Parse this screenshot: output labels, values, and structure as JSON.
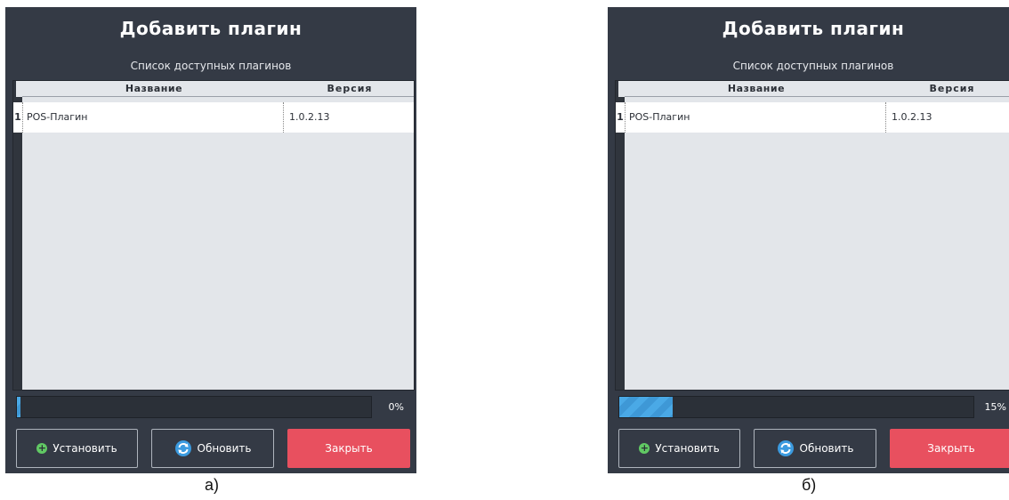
{
  "panels": [
    {
      "title": "Добавить плагин",
      "subtitle": "Список доступных плагинов",
      "table": {
        "columns": [
          "Название",
          "Версия"
        ],
        "rows": [
          {
            "num": "1",
            "name": "POS-Плагин",
            "version": "1.0.2.13"
          }
        ]
      },
      "progress": {
        "value": 0.0,
        "label": "0%"
      },
      "buttons": {
        "install": "Установить",
        "refresh": "Обновить",
        "close": "Закрыть"
      },
      "caption": "а)"
    },
    {
      "title": "Добавить плагин",
      "subtitle": "Список доступных плагинов",
      "table": {
        "columns": [
          "Название",
          "Версия"
        ],
        "rows": [
          {
            "num": "1",
            "name": "POS-Плагин",
            "version": "1.0.2.13"
          }
        ]
      },
      "progress": {
        "value": 0.15,
        "label": "15%"
      },
      "buttons": {
        "install": "Установить",
        "refresh": "Обновить",
        "close": "Закрыть"
      },
      "caption": "б)"
    }
  ],
  "icons": {
    "install": "plus-circle-icon",
    "refresh": "refresh-icon"
  },
  "colors": {
    "panel_bg": "#343a45",
    "close_button": "#e8505f",
    "progress_fill": "#4aa9e6",
    "install_icon": "#61c964",
    "refresh_icon": "#3b9be0"
  }
}
